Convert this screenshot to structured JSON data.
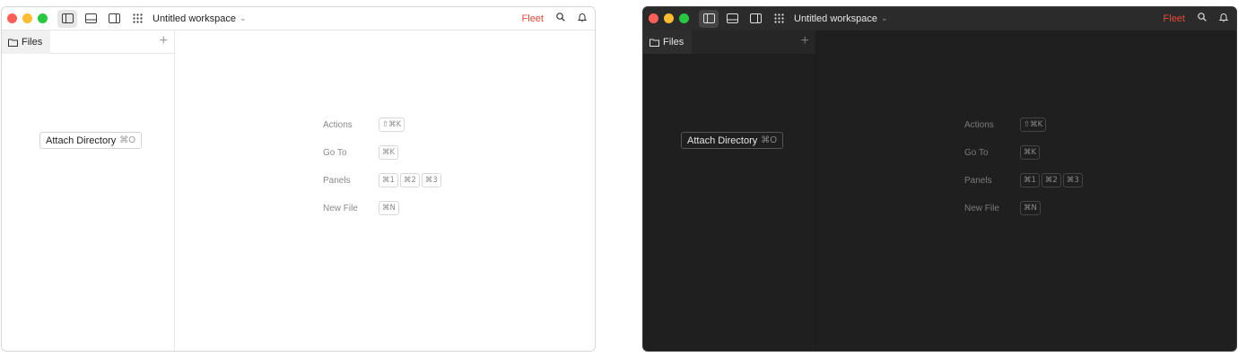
{
  "colors": {
    "traffic_red": "#ff5f57",
    "traffic_yellow": "#febc2e",
    "traffic_green": "#28c840",
    "brand": "#e5493a"
  },
  "windows": [
    {
      "theme": "light",
      "titlebar": {
        "workspace_title": "Untitled workspace",
        "brand_label": "Fleet"
      },
      "sidebar": {
        "tab_label": "Files",
        "attach_label": "Attach Directory",
        "attach_shortcut": "⌘O"
      },
      "hints": [
        {
          "label": "Actions",
          "keys": [
            "⇧⌘K"
          ]
        },
        {
          "label": "Go To",
          "keys": [
            "⌘K"
          ]
        },
        {
          "label": "Panels",
          "keys": [
            "⌘1",
            "⌘2",
            "⌘3"
          ]
        },
        {
          "label": "New File",
          "keys": [
            "⌘N"
          ]
        }
      ]
    },
    {
      "theme": "dark",
      "titlebar": {
        "workspace_title": "Untitled workspace",
        "brand_label": "Fleet"
      },
      "sidebar": {
        "tab_label": "Files",
        "attach_label": "Attach Directory",
        "attach_shortcut": "⌘O"
      },
      "hints": [
        {
          "label": "Actions",
          "keys": [
            "⇧⌘K"
          ]
        },
        {
          "label": "Go To",
          "keys": [
            "⌘K"
          ]
        },
        {
          "label": "Panels",
          "keys": [
            "⌘1",
            "⌘2",
            "⌘3"
          ]
        },
        {
          "label": "New File",
          "keys": [
            "⌘N"
          ]
        }
      ]
    }
  ]
}
